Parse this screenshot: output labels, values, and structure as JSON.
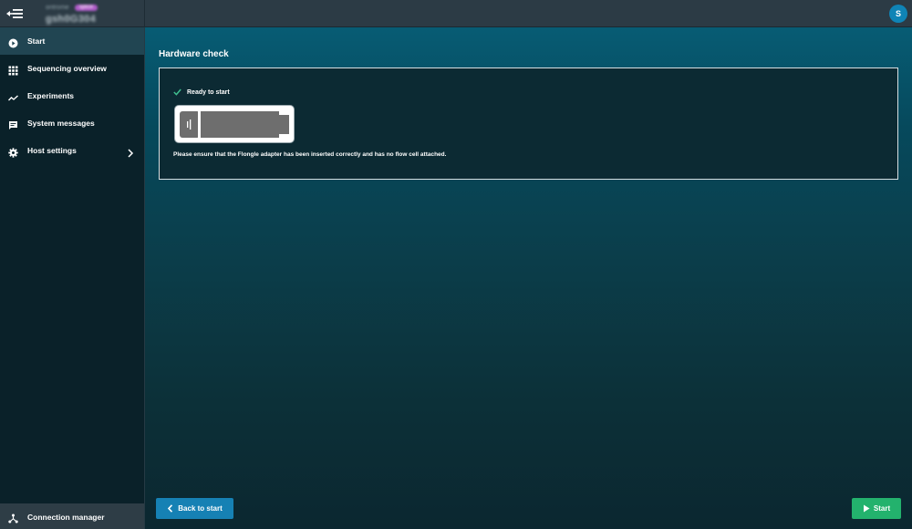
{
  "topbar": {
    "host_subtitle": "ontrome",
    "host_badge": "splice",
    "host_name": "gsh0G304",
    "avatar_initial": "S",
    "menu_icon": "menu-collapse-icon"
  },
  "sidebar": {
    "items": [
      {
        "label": "Start",
        "icon": "play-circle-icon",
        "active": true
      },
      {
        "label": "Sequencing overview",
        "icon": "grid-icon",
        "active": false
      },
      {
        "label": "Experiments",
        "icon": "trend-line-icon",
        "active": false
      },
      {
        "label": "System messages",
        "icon": "message-icon",
        "active": false
      },
      {
        "label": "Host settings",
        "icon": "gear-icon",
        "active": false,
        "has_submenu": true
      }
    ],
    "footer": {
      "label": "Connection manager",
      "icon": "network-icon"
    }
  },
  "main": {
    "title": "Hardware check",
    "card": {
      "status": "Ready to start",
      "status_icon": "check-icon",
      "device_image": "flongle-adapter-image",
      "message": "Please ensure that the Flongle adapter has been inserted correctly and has no flow cell attached."
    }
  },
  "actions": {
    "back_label": "Back to start",
    "start_label": "Start"
  },
  "colors": {
    "accent_blue": "#1681b4",
    "start_green": "#23b26d",
    "check_green": "#3fbf8f",
    "sidebar_active": "#214552"
  }
}
